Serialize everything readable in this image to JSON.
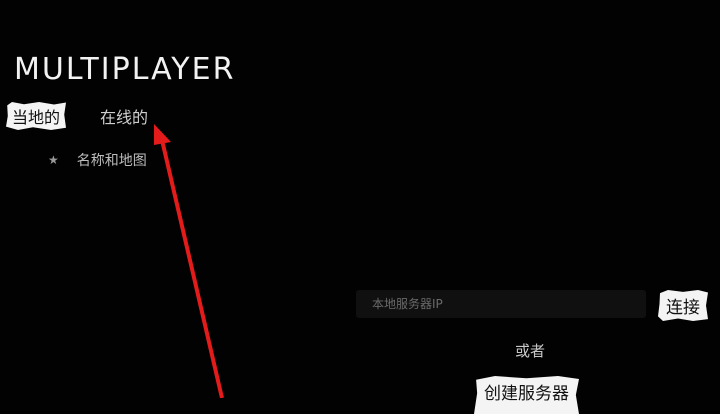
{
  "header": {
    "title": "MULTIPLAYER"
  },
  "tabs": [
    {
      "label": "当地的",
      "selected": true
    },
    {
      "label": "在线的",
      "selected": false
    }
  ],
  "sort": {
    "icon": "star-icon",
    "label": "名称和地图"
  },
  "server_ip": {
    "placeholder": "本地服务器IP",
    "value": ""
  },
  "connect_label": "连接",
  "or_label": "或者",
  "create_server_label": "创建服务器",
  "colors": {
    "background": "#020202",
    "accent": "#f4f4f4",
    "arrow": "#e41b1b"
  }
}
